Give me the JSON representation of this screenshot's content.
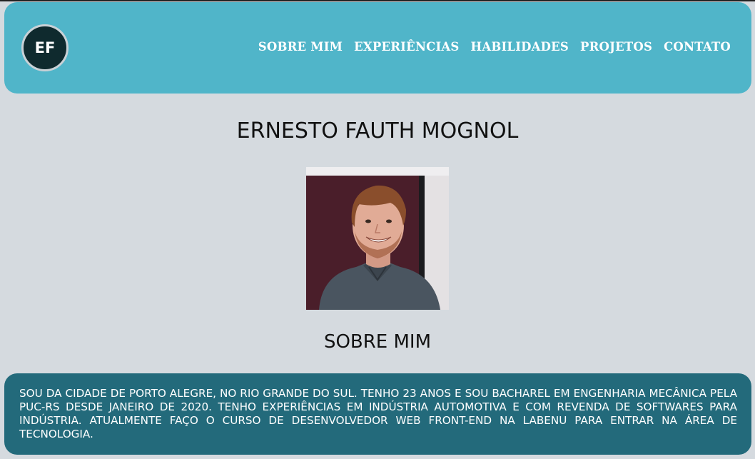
{
  "header": {
    "logo_initials": "EF",
    "nav": [
      {
        "label": "SOBRE MIM"
      },
      {
        "label": "EXPERIÊNCIAS"
      },
      {
        "label": "HABILIDADES"
      },
      {
        "label": "PROJETOS"
      },
      {
        "label": "CONTATO"
      }
    ],
    "background_color": "#50b5c9"
  },
  "main": {
    "name": "ERNESTO FAUTH MOGNOL",
    "photo_icon": "profile-photo",
    "about_title": "SOBRE MIM",
    "about_text": "SOU DA CIDADE DE PORTO ALEGRE, NO RIO GRANDE DO SUL. TENHO 23 ANOS E SOU BACHAREL EM ENGENHARIA MECÂNICA PELA PUC-RS DESDE JANEIRO DE 2020. TENHO EXPERIÊNCIAS EM INDÚSTRIA AUTOMOTIVA E COM REVENDA DE SOFTWARES PARA INDÚSTRIA. ATUALMENTE FAÇO O CURSO DE DESENVOLVEDOR WEB FRONT-END NA LABENU PARA ENTRAR NA ÁREA DE TECNOLOGIA.",
    "about_background_color": "#236a7b"
  }
}
